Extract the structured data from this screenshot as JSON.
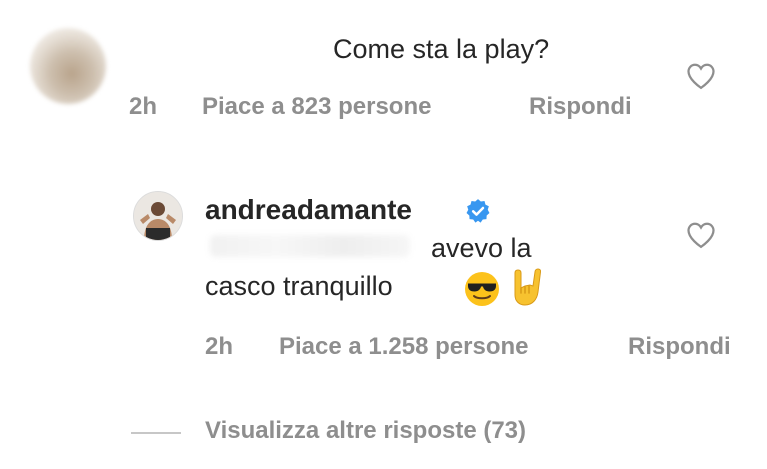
{
  "comment": {
    "text": "Come sta la play?",
    "time": "2h",
    "likes": "Piace a 823 persone",
    "reply_label": "Rispondi",
    "icons": {
      "avatar": "blurred-avatar",
      "like": "heart-outline-icon"
    }
  },
  "reply": {
    "username": "andreadamante",
    "text_line1": "avevo la",
    "text_line2": "casco tranquillo",
    "emojis": [
      "smiling-face-with-sunglasses",
      "sign-of-the-horns"
    ],
    "time": "2h",
    "likes": "Piace a 1.258 persone",
    "reply_label": "Rispondi",
    "icons": {
      "verified": "verified-badge-icon",
      "like": "heart-outline-icon"
    }
  },
  "more_replies": "Visualizza altre risposte (73)",
  "colors": {
    "text": "#262626",
    "secondary": "#8e8e8e",
    "verified": "#3897f0"
  }
}
